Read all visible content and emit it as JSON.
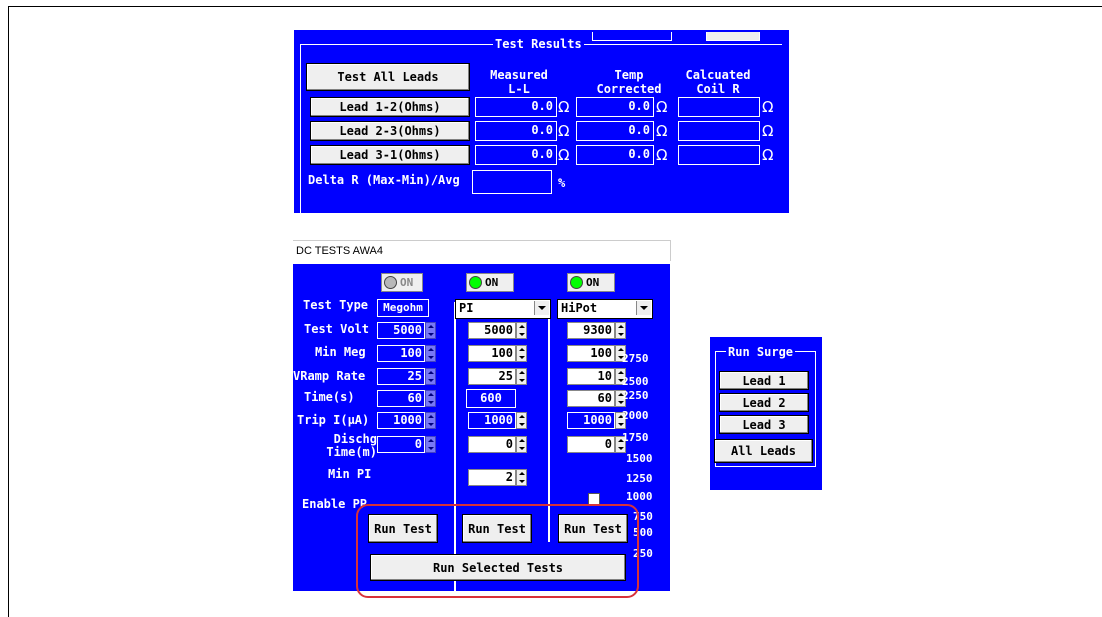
{
  "test_results": {
    "title": "Test Results",
    "test_all_label": "Test All Leads",
    "col_measured": "Measured\nL-L",
    "col_temp": "Temp\nCorrected",
    "col_calc": "Calcuated\nCoil R",
    "leads": [
      {
        "label": "Lead 1-2(Ohms)",
        "measured": "0.0",
        "temp": "0.0",
        "calc": ""
      },
      {
        "label": "Lead 2-3(Ohms)",
        "measured": "0.0",
        "temp": "0.0",
        "calc": ""
      },
      {
        "label": "Lead 3-1(Ohms)",
        "measured": "0.0",
        "temp": "0.0",
        "calc": ""
      }
    ],
    "ohm_symbol": "Ω",
    "delta_label": "Delta R (Max-Min)/Avg",
    "delta_value": "",
    "percent": "%"
  },
  "dc_tests": {
    "window_title": "DC TESTS  AWA4",
    "on_labels": [
      "ON",
      "ON",
      "ON"
    ],
    "row_labels": {
      "test_type": "Test Type",
      "test_volt": "Test Volt",
      "min_meg": "Min Meg",
      "vramp": "VRamp Rate",
      "time": "Time(s)",
      "trip": "Trip I(µA)",
      "dischg": "Dischg\nTime(m)",
      "min_pi": "Min PI",
      "enable_pp": "Enable PP"
    },
    "col1": {
      "type": "Megohm",
      "volt": "5000",
      "min_meg": "100",
      "vramp": "25",
      "time": "60",
      "trip": "1000",
      "dischg": "0"
    },
    "col2": {
      "type": "PI",
      "volt": "5000",
      "min_meg": "100",
      "vramp": "25",
      "time": "600",
      "trip": "1000",
      "dischg": "0",
      "min_pi": "2"
    },
    "col3": {
      "type": "HiPot",
      "volt": "9300",
      "min_meg": "100",
      "vramp": "10",
      "time": "60",
      "trip": "1000",
      "dischg": "0"
    },
    "axis": [
      "2750",
      "2500",
      "2250",
      "2000",
      "1750",
      "1500",
      "1250",
      "1000",
      "750",
      "500",
      "250"
    ],
    "run_test": "Run Test",
    "run_selected": "Run Selected Tests"
  },
  "run_surge": {
    "title": "Run Surge",
    "lead1": "Lead 1",
    "lead2": "Lead 2",
    "lead3": "Lead 3",
    "all": "All Leads"
  },
  "colors": {
    "panel_blue": "#0000ff",
    "highlight_red": "#d8323a",
    "led_green": "#00ff00"
  }
}
